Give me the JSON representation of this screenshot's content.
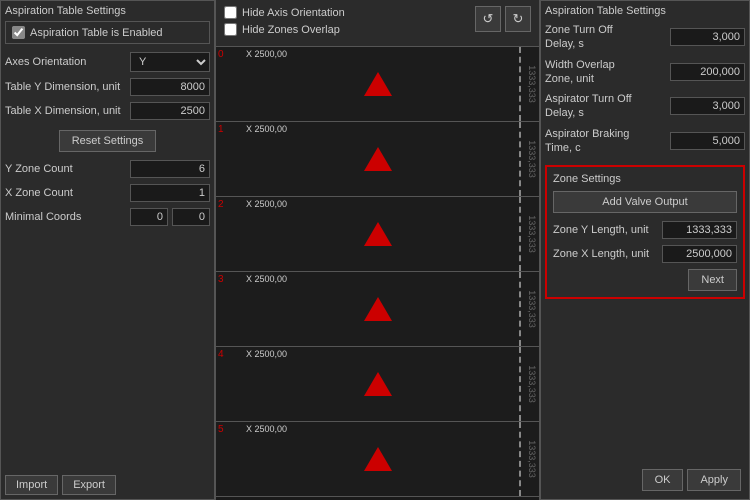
{
  "left_panel": {
    "title": "Aspiration Table Settings",
    "checkbox_label": "Aspiration Table is Enabled",
    "checkbox_checked": true,
    "axes_label": "Axes Orientation",
    "axes_value": "Y",
    "table_y_label": "Table Y Dimension, unit",
    "table_y_value": "8000",
    "table_x_label": "Table X Dimension, unit",
    "table_x_value": "2500",
    "reset_btn": "Reset Settings",
    "y_zone_label": "Y Zone Count",
    "y_zone_value": "6",
    "x_zone_label": "X Zone Count",
    "x_zone_value": "1",
    "coords_label": "Minimal Coords",
    "coords_x": "0",
    "coords_y": "0",
    "import_btn": "Import",
    "export_btn": "Export"
  },
  "middle_options": {
    "hide_axis": "Hide Axis Orientation",
    "hide_zones": "Hide Zones Overlap",
    "undo_icon": "↺",
    "redo_icon": "↻"
  },
  "zones": [
    {
      "label": "0",
      "x_val": "X  2500,00",
      "side_text": "1333,333"
    },
    {
      "label": "1",
      "x_val": "X  2500,00",
      "side_text": "1333,333"
    },
    {
      "label": "2",
      "x_val": "X  2500,00",
      "side_text": "1333,333"
    },
    {
      "label": "3",
      "x_val": "X  2500,00",
      "side_text": "1333,333"
    },
    {
      "label": "4",
      "x_val": "X  2500,00",
      "side_text": "1333,333"
    },
    {
      "label": "5",
      "x_val": "X  2500,00",
      "side_text": "1333,333"
    }
  ],
  "right_panel": {
    "title": "Aspiration Table Settings",
    "zone_turn_off_label": "Zone Turn Off Delay, s",
    "zone_turn_off_value": "3,000",
    "width_overlap_label": "Width Overlap Zone, unit",
    "width_overlap_value": "200,000",
    "aspirator_turn_off_label": "Aspirator Turn Off Delay, s",
    "aspirator_turn_off_value": "3,000",
    "aspirator_braking_label": "Aspirator Braking Time, c",
    "aspirator_braking_value": "5,000",
    "zone_settings_title": "Zone Settings",
    "add_valve_btn": "Add Valve Output",
    "zone_y_label": "Zone Y Length, unit",
    "zone_y_value": "1333,333",
    "zone_x_label": "Zone X Length, unit",
    "zone_x_value": "2500,000",
    "next_btn": "Next",
    "ok_btn": "OK",
    "apply_btn": "Apply"
  }
}
